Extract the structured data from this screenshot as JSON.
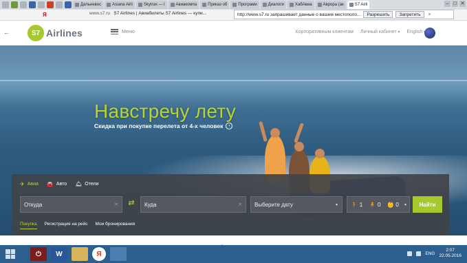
{
  "browser": {
    "pinned_tabs": [
      "",
      "",
      "",
      "",
      "",
      "",
      "",
      ""
    ],
    "tabs": [
      {
        "label": "Дальневос"
      },
      {
        "label": "Asiana Airli"
      },
      {
        "label": "Skytrax — l"
      },
      {
        "label": "Авиакомпа"
      },
      {
        "label": "Приказ об"
      },
      {
        "label": "Програми"
      },
      {
        "label": "Диалоги"
      },
      {
        "label": "ХабАвиа"
      },
      {
        "label": "Аврора (ак"
      },
      {
        "label": "S7 Airli"
      }
    ],
    "window_buttons": [
      "–",
      "□",
      "✕"
    ],
    "yandex_letter": "Я",
    "url": "www.s7.ru",
    "page_title": "S7 Airlines | Авиабилеты S7 Airlines — купи...",
    "geo_prompt": {
      "text": "http://www.s7.ru запрашивает данные о вашем местополо...",
      "allow": "Разрешить",
      "deny": "Запретить",
      "close": "×"
    }
  },
  "nav": {
    "back": "←",
    "logo_mark": "S7",
    "logo_text": "Airlines",
    "menu_label": "Меню",
    "corporate": "Корпоративным клиентам",
    "cabinet": "Личный кабинет",
    "language": "English"
  },
  "hero": {
    "headline": "Навстречу лету",
    "subline": "Скидка при покупке перелета от 4-х человек",
    "subline_arrow": "›"
  },
  "booking": {
    "modes": [
      {
        "label": "Авиа",
        "glyph": "✈"
      },
      {
        "label": "Авто",
        "glyph": "🚘"
      },
      {
        "label": "Отели",
        "glyph": "🛎"
      }
    ],
    "from_placeholder": "Откуда",
    "to_placeholder": "Куда",
    "clear": "✕",
    "swap": "⇄",
    "date_placeholder": "Выберите дату",
    "caret": "▾",
    "passengers": [
      {
        "glyph": "🚶",
        "count": "1"
      },
      {
        "glyph": "🧍",
        "count": "0"
      },
      {
        "glyph": "👶",
        "count": "0"
      }
    ],
    "find_label": "Найти",
    "links": [
      "Покупка",
      "Регистрация на рейс",
      "Мои бронирования"
    ]
  },
  "carousel": {
    "count": 5,
    "active_index": 1
  },
  "taskbar": {
    "word": "W",
    "yandex": "Я",
    "lang": "ENG",
    "time": "2:07",
    "date": "22.05.2016"
  },
  "colors": {
    "accent": "#b8d432",
    "brand_green": "#a6c92d",
    "panel": "#404348"
  }
}
